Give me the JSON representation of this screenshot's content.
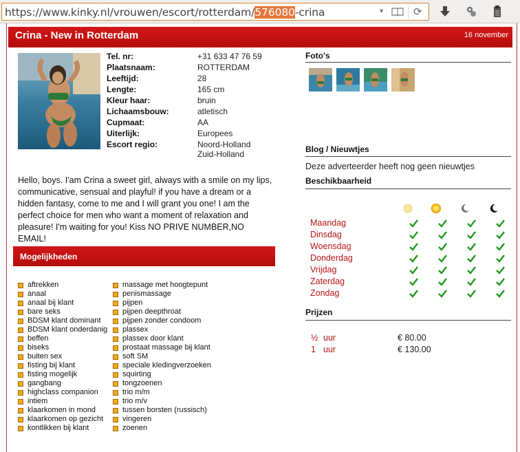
{
  "browser": {
    "url_prefix": "https://www.kinky.nl/vrouwen/escort/rotterdam/",
    "url_highlight": "576080",
    "url_suffix": "-crina"
  },
  "listing": {
    "title": "Crina - New in Rotterdam",
    "date": "16 november",
    "details": [
      {
        "label": "Tel. nr:",
        "value": "+31 633 47 76 59"
      },
      {
        "label": "Plaatsnaam:",
        "value": "ROTTERDAM"
      },
      {
        "label": "Leeftijd:",
        "value": "28"
      },
      {
        "label": "Lengte:",
        "value": "165 cm"
      },
      {
        "label": "Kleur haar:",
        "value": "bruin"
      },
      {
        "label": "Lichaamsbouw:",
        "value": "atletisch"
      },
      {
        "label": "Cupmaat:",
        "value": "AA"
      },
      {
        "label": "Uiterlijk:",
        "value": "Europees"
      },
      {
        "label": "Escort regio:",
        "value": "Noord-Holland",
        "value2": "Zuid-Holland"
      }
    ],
    "description": "Hello, boys. I'am Crina a sweet girl, always with a smile on my lips, communicative, sensual and playful! if you have a dream or a hidden fantasy, come to me and I will grant you one! I am the perfect choice for men who want a moment of relaxation and pleasure! I'm waiting for you! Kiss NO PRIVE NUMBER,NO EMAIL!"
  },
  "options": {
    "title": "Mogelijkheden",
    "col1": [
      "aftrekken",
      "anaal",
      "anaal bij klant",
      "bare seks",
      "BDSM klant dominant",
      "BDSM klant onderdanig",
      "beffen",
      "biseks",
      "buiten sex",
      "fisting bij klant",
      "fisting mogelijk",
      "gangbang",
      "highclass companion",
      "intiem",
      "klaarkomen in mond",
      "klaarkomen op gezicht",
      "kontlikken bij klant"
    ],
    "col2": [
      "massage met hoogtepunt",
      "penismassage",
      "pijpen",
      "pijpen deepthroat",
      "pijpen zonder condoom",
      "plassex",
      "plassex door klant",
      "prostaat massage bij klant",
      "soft SM",
      "speciale kledingverzoeken",
      "squirting",
      "tongzoenen",
      "trio m/m",
      "trio m/v",
      "tussen borsten (russisch)",
      "vingeren",
      "zoenen"
    ]
  },
  "sidebar": {
    "photos_title": "Foto's",
    "blog_title": "Blog / Nieuwtjes",
    "blog_text": "Deze adverteerder heeft nog geen nieuwtjes",
    "availability_title": "Beschikbaarheid",
    "availability_icons": [
      "sun-dim-icon",
      "sun-icon",
      "moon-icon",
      "moon-dark-icon"
    ],
    "days": [
      "Maandag",
      "Dinsdag",
      "Woensdag",
      "Donderdag",
      "Vrijdag",
      "Zaterdag",
      "Zondag"
    ],
    "prices_title": "Prijzen",
    "prices": [
      {
        "amount": "½",
        "unit": "uur",
        "price": "€ 80.00"
      },
      {
        "amount": "1",
        "unit": "uur",
        "price": "€ 130.00"
      }
    ]
  },
  "colors": {
    "header_red": "#c41010",
    "day_red": "#b81414",
    "check_green": "#1d9a1d",
    "bullet_orange": "#f0a820"
  }
}
